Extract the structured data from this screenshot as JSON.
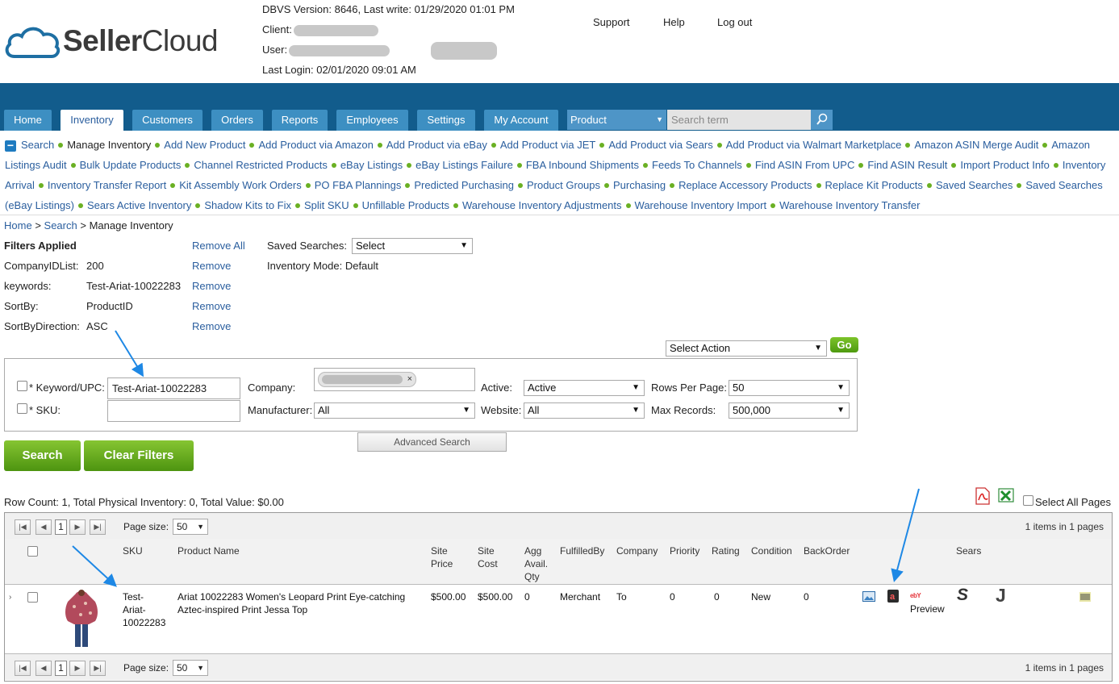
{
  "header": {
    "logo_text_bold": "Seller",
    "logo_text_regular": "Cloud",
    "dbvs": "DBVS Version: 8646, Last write: 01/29/2020 01:01 PM",
    "client_label": "Client:",
    "user_label": "User:",
    "last_login": "Last Login: 02/01/2020 09:01 AM",
    "links": [
      "Support",
      "Help",
      "Log out"
    ]
  },
  "nav": {
    "tabs": [
      "Home",
      "Inventory",
      "Customers",
      "Orders",
      "Reports",
      "Employees",
      "Settings",
      "My Account"
    ],
    "active_tab": "Inventory",
    "search_type": "Product",
    "search_placeholder": "Search term"
  },
  "sublinks": [
    "Search",
    "Manage Inventory",
    "Add New Product",
    "Add Product via Amazon",
    "Add Product via eBay",
    "Add Product via JET",
    "Add Product via Sears",
    "Add Product via Walmart Marketplace",
    "Amazon ASIN Merge Audit",
    "Amazon Listings Audit",
    "Bulk Update Products",
    "Channel Restricted Products",
    "eBay Listings",
    "eBay Listings Failure",
    "FBA Inbound Shipments",
    "Feeds To Channels",
    "Find ASIN From UPC",
    "Find ASIN Result",
    "Import Product Info",
    "Inventory Arrival",
    "Inventory Transfer Report",
    "Kit Assembly Work Orders",
    "PO FBA Plannings",
    "Predicted Purchasing",
    "Product Groups",
    "Purchasing",
    "Replace Accessory Products",
    "Replace Kit Products",
    "Saved Searches",
    "Saved Searches (eBay Listings)",
    "Sears Active Inventory",
    "Shadow Kits to Fix",
    "Split SKU",
    "Unfillable Products",
    "Warehouse Inventory Adjustments",
    "Warehouse Inventory Import",
    "Warehouse Inventory Transfer"
  ],
  "breadcrumb": {
    "home": "Home",
    "sep": ">",
    "search": "Search",
    "current": "Manage Inventory"
  },
  "filters": {
    "title": "Filters Applied",
    "remove_all": "Remove All",
    "remove": "Remove",
    "items": [
      {
        "label": "CompanyIDList:",
        "value": "200"
      },
      {
        "label": "keywords:",
        "value": "Test-Ariat-10022283"
      },
      {
        "label": "SortBy:",
        "value": "ProductID"
      },
      {
        "label": "SortByDirection:",
        "value": "ASC"
      }
    ],
    "saved_searches_label": "Saved Searches:",
    "saved_searches_value": "Select",
    "inventory_mode": "Inventory Mode: Default",
    "select_action": "Select Action",
    "go": "Go"
  },
  "panel": {
    "keyword_label": "* Keyword/UPC:",
    "keyword_value": "Test-Ariat-10022283",
    "sku_label": "* SKU:",
    "sku_value": "",
    "company_label": "Company:",
    "manufacturer_label": "Manufacturer:",
    "manufacturer_value": "All",
    "active_label": "Active:",
    "active_value": "Active",
    "website_label": "Website:",
    "website_value": "All",
    "rows_label": "Rows Per Page:",
    "rows_value": "50",
    "max_label": "Max Records:",
    "max_value": "500,000",
    "advanced": "Advanced Search",
    "search_btn": "Search",
    "clear_btn": "Clear Filters"
  },
  "grid": {
    "row_count": "Row Count: 1, Total Physical Inventory: 0, Total Value: $0.00",
    "select_all_pages": "Select All Pages",
    "page_num": "1",
    "page_size_label": "Page size:",
    "page_size": "50",
    "items_text": "1 items in 1 pages",
    "headers": {
      "sku": "SKU",
      "name": "Product Name",
      "site_price": "Site Price",
      "site_cost": "Site Cost",
      "agg": "Agg Avail. Qty",
      "fulfilled": "FulfilledBy",
      "company": "Company",
      "priority": "Priority",
      "rating": "Rating",
      "condition": "Condition",
      "backorder": "BackOrder",
      "sears": "Sears"
    },
    "row": {
      "sku": "Test-Ariat-10022283",
      "name": "Ariat 10022283 Women's Leopard Print Eye-catching Aztec-inspired Print Jessa Top",
      "site_price": "$500.00",
      "site_cost": "$500.00",
      "agg": "0",
      "fulfilled": "Merchant",
      "company": "To",
      "priority": "0",
      "rating": "0",
      "condition": "New",
      "backorder": "0",
      "ebay_logo": "ebY",
      "preview": "Preview",
      "sears_glyph": "S",
      "jet_glyph": "J"
    }
  },
  "colors": {
    "nav_band": "#125c8c",
    "tab": "#3d8fc2",
    "link": "#2a5e9e",
    "green": "#6ab023",
    "arrow": "#1e88e5"
  }
}
